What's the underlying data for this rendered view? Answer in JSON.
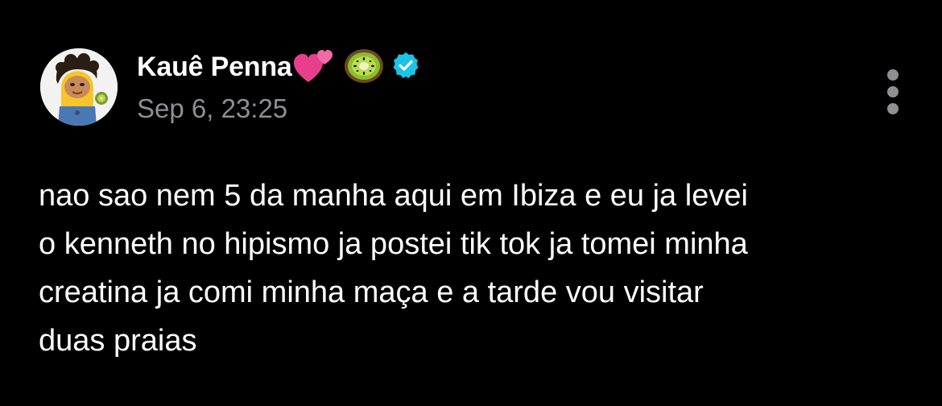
{
  "author": {
    "display_name": "Kauê Penna",
    "name_emojis": [
      "two-hearts-icon",
      "kiwi-icon"
    ],
    "verified": true,
    "verified_color": "#1bc3e7"
  },
  "post": {
    "timestamp": "Sep 6, 23:25",
    "lines": [
      "nao sao nem 5 da manha aqui em Ibiza e eu ja levei",
      "o kenneth no hipismo ja postei tik tok ja tomei minha",
      "creatina ja comi minha maça e a tarde vou visitar",
      "duas praias"
    ]
  },
  "theme": {
    "background": "#000000",
    "text": "#ffffff",
    "secondary_text": "#8e8e93"
  }
}
